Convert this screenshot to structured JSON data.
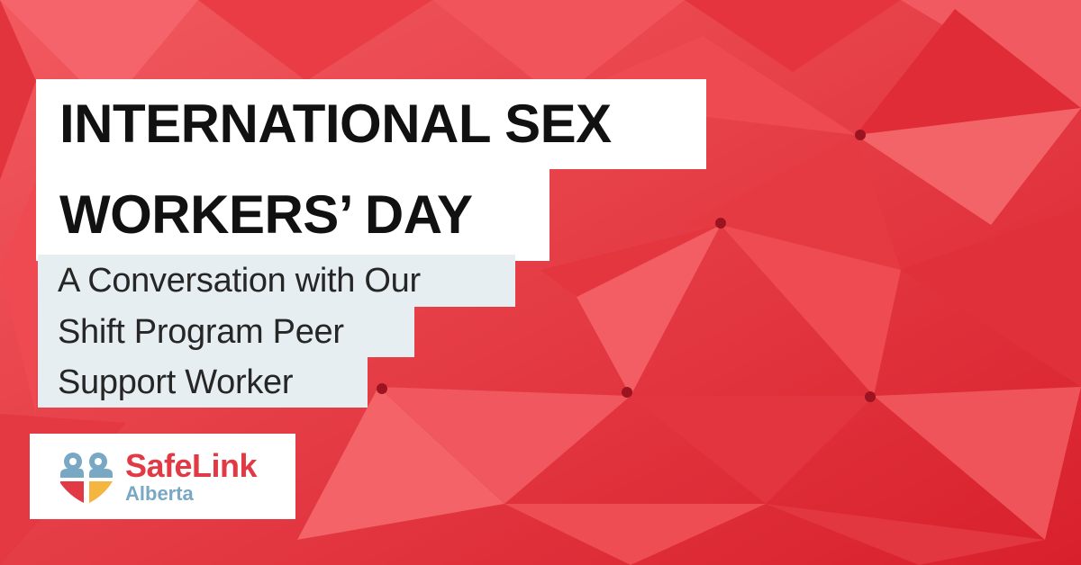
{
  "banner": {
    "title_line_1": "INTERNATIONAL SEX",
    "title_line_2": "WORKERS’ DAY",
    "subtitle_line_1": "A Conversation with Our",
    "subtitle_line_2": "Shift Program Peer",
    "subtitle_line_3": "Support Worker"
  },
  "logo": {
    "name": "SafeLink",
    "region": "Alberta",
    "icon": "heart-people-icon"
  },
  "colors": {
    "background_red": "#e8323a",
    "title_box": "#ffffff",
    "subtitle_box": "#e6eef2",
    "logo_red": "#e23a45",
    "logo_blue": "#79a8c4",
    "logo_yellow": "#f4b63f"
  }
}
